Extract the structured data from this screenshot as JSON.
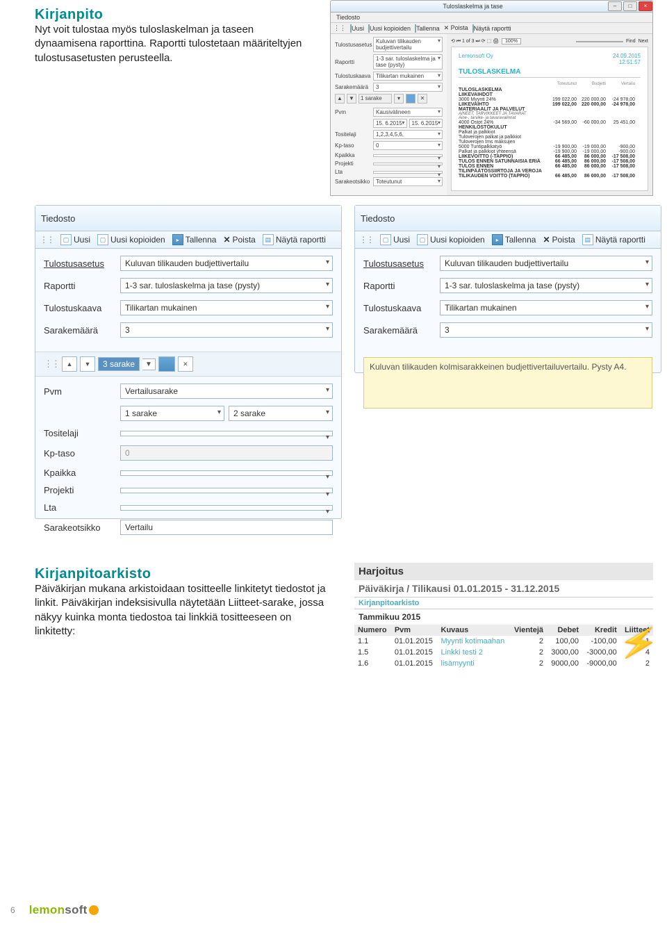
{
  "domain": "Document",
  "intro": {
    "heading": "Kirjanpito",
    "paragraph": "Nyt voit tulostaa myös tuloslaskelman ja taseen dynaamisena raporttina. Raportti tulostetaan määriteltyjen tulostusasetusten perusteella."
  },
  "report_window": {
    "title": "Tuloslaskelma ja tase",
    "menu_tiedosto": "Tiedosto",
    "toolbar": {
      "uusi": "Uusi",
      "uusi_kopioiden": "Uusi kopioiden",
      "tallenna": "Tallenna",
      "poista": "Poista",
      "nayta_raportti": "Näytä raportti"
    },
    "params": {
      "tulostusasetus_lbl": "Tulostusasetus",
      "tulostusasetus_val": "Kuluvan tilikauden budjettivertailu",
      "raportti_lbl": "Raportti",
      "raportti_val": "1-3 sar. tuloslaskelma ja tase (pysty)",
      "tulostuskaava_lbl": "Tulostuskaava",
      "tulostuskaava_val": "Tilikartan mukainen",
      "sarakemaara_lbl": "Sarakemäärä",
      "sarakemaara_val": "3",
      "sarake_selector": "1 sarake",
      "pvm_lbl": "Pvm",
      "pvm_val": "Kausivälineen",
      "pvm_from": "15. 6.2015",
      "pvm_to": "15. 6.2015",
      "tositelaji_lbl": "Tositelaji",
      "tositelaji_val": "1,2,3,4,5,6,",
      "kptaso_lbl": "Kp-taso",
      "kptaso_val": "0",
      "kpaikka_lbl": "Kpaikka",
      "projekti_lbl": "Projekti",
      "lta_lbl": "Lta",
      "sarakeotsikko_lbl": "Sarakeotsikko",
      "sarakeotsikko_val": "Toteutunut"
    },
    "zoom": "100%",
    "find": "Find",
    "next": "Next",
    "paper": {
      "company": "Lemonsoft Oy",
      "date": "24.09.2015",
      "time": "12:51:57",
      "title": "TULOSLASKELMA",
      "col_hdrs": [
        "Toteutunut",
        "Budjetti",
        "Vertailu"
      ],
      "rows": [
        {
          "l": "TULOSLASKELMA",
          "b": true
        },
        {
          "l": "LIIKEVAIHDOT",
          "b": true
        },
        {
          "l": "3000 Myynti 24%",
          "v": [
            "199 022,00",
            "220 000,00",
            "-24 978,00"
          ]
        },
        {
          "l": "LIIKEVAIHTO",
          "b": true,
          "v": [
            "199 022,00",
            "220 000,00",
            "-24 978,00"
          ]
        },
        {
          "l": "MATERIAALIT JA PALVELUT",
          "b": true
        },
        {
          "l": "AINEET, TARVIKKEET JA TAVARAT",
          "it": true
        },
        {
          "l": "Aine-, tarvike- ja tavaravalinnat",
          "it": true
        },
        {
          "l": "4000 Ostot 24%",
          "v": [
            "-34 569,00",
            "-60 000,00",
            "25 451,00"
          ]
        },
        {
          "l": "HENKILÖSTÖKULUT",
          "b": true
        },
        {
          "l": "Palkat ja palkkiot"
        },
        {
          "l": "Tuloverojen palkat ja palkkiot"
        },
        {
          "l": "Tuloverojen tms maksujen"
        },
        {
          "l": "5000 Tuntipalkkatyö",
          "v": [
            "-19 900,00",
            "-19 000,00",
            "-900,00"
          ]
        },
        {
          "l": "Palkat ja palkkiot yhteensä",
          "v": [
            "-19 900,00",
            "-19 000,00",
            "-900,00"
          ]
        },
        {
          "l": "LIIKEVOITTO (-TAPPIO)",
          "b": true,
          "v": [
            "66 485,00",
            "86 000,00",
            "-17 508,00"
          ]
        },
        {
          "l": "TULOS ENNEN SATUNNAISIA ERIÄ",
          "b": true,
          "v": [
            "66 485,00",
            "86 000,00",
            "-17 508,00"
          ]
        },
        {
          "l": "TULOS ENNEN TILINPÄÄTÖSSIIRTOJA JA VEROJA",
          "b": true,
          "v": [
            "66 485,00",
            "86 000,00",
            "-17 508,00"
          ]
        },
        {
          "l": "TILIKAUDEN VOITTO (TAPPIO)",
          "b": true,
          "v": [
            "66 485,00",
            "86 000,00",
            "-17 508,00"
          ]
        }
      ]
    }
  },
  "panel": {
    "menu": "Tiedosto",
    "toolbar": {
      "uusi": "Uusi",
      "uusi_kopioiden": "Uusi kopioiden",
      "tallenna": "Tallenna",
      "poista": "Poista",
      "nayta_raportti": "Näytä raportti"
    },
    "fields": {
      "tulostusasetus_lbl": "Tulostusasetus",
      "tulostusasetus_val": "Kuluvan tilikauden budjettivertailu",
      "raportti_lbl": "Raportti",
      "raportti_val": "1-3 sar. tuloslaskelma ja tase (pysty)",
      "tulostuskaava_lbl": "Tulostuskaava",
      "tulostuskaava_val": "Tilikartan mukainen",
      "sarakemaara_lbl": "Sarakemäärä",
      "sarakemaara_val": "3"
    },
    "spin_value": "3 sarake",
    "lower": {
      "pvm_lbl": "Pvm",
      "pvm_val": "Vertailusarake",
      "sar1": "1 sarake",
      "sar2": "2 sarake",
      "tositelaji_lbl": "Tositelaji",
      "kptaso_lbl": "Kp-taso",
      "kptaso_val": "0",
      "kpaikka_lbl": "Kpaikka",
      "projekti_lbl": "Projekti",
      "lta_lbl": "Lta",
      "sarakeotsikko_lbl": "Sarakeotsikko",
      "sarakeotsikko_val": "Vertailu"
    },
    "note": "Kuluvan tilikauden kolmisarakkeinen budjettivertailuvertailu. Pysty A4."
  },
  "arkisto": {
    "heading": "Kirjanpitoarkisto",
    "paragraph": "Päiväkirjan mukana arkistoidaan tositteelle linkitetyt tiedostot ja linkit. Päiväkirjan indeksisivulla näytetään Liitteet-sarake, jossa näkyy kuinka monta tiedostoa tai linkkiä tositteeseen on linkitetty:"
  },
  "harjoitus": {
    "title": "Harjoitus",
    "sub": "Päiväkirja / Tilikausi 01.01.2015 - 31.12.2015",
    "arkisto_label": "Kirjanpitoarkisto",
    "month": "Tammikuu 2015",
    "cols": [
      "Numero",
      "Pvm",
      "Kuvaus",
      "Vientejä",
      "Debet",
      "Kredit",
      "Liitteet"
    ],
    "rows": [
      {
        "n": "1.1",
        "p": "01.01.2015",
        "k": "Myynti kotimaahan",
        "v": "2",
        "d": "100,00",
        "kr": "-100,00",
        "l": "1"
      },
      {
        "n": "1.5",
        "p": "01.01.2015",
        "k": "Linkki testi 2",
        "v": "2",
        "d": "3000,00",
        "kr": "-3000,00",
        "l": "4"
      },
      {
        "n": "1.6",
        "p": "01.01.2015",
        "k": "lisämyynti",
        "v": "2",
        "d": "9000,00",
        "kr": "-9000,00",
        "l": "2"
      }
    ]
  },
  "footer": {
    "page": "6",
    "logo_lem": "lemon",
    "logo_soft": "soft"
  }
}
